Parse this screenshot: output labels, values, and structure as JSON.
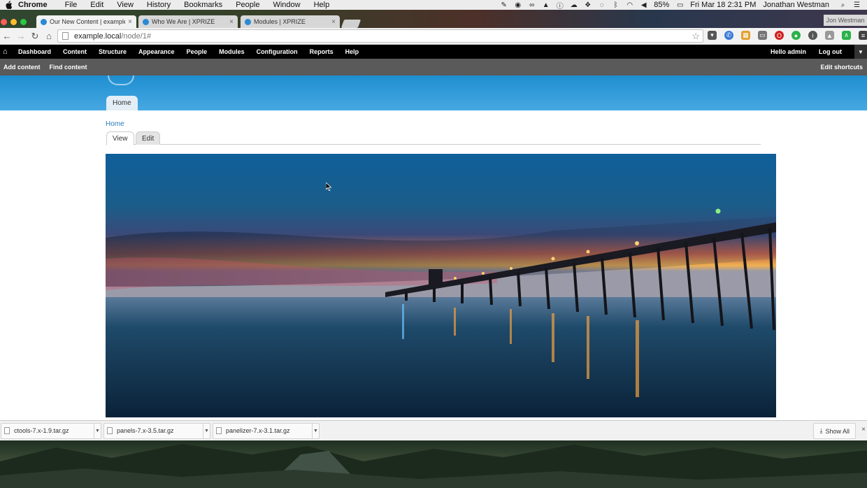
{
  "mac_menubar": {
    "app_name": "Chrome",
    "menus": [
      "File",
      "Edit",
      "View",
      "History",
      "Bookmarks",
      "People",
      "Window",
      "Help"
    ],
    "battery": "85%",
    "clock": "Fri Mar 18  2:31 PM",
    "user": "Jonathan Westman"
  },
  "browser": {
    "tabs": [
      {
        "title": "Our New Content | example",
        "active": true
      },
      {
        "title": "Who We Are | XPRIZE",
        "active": false
      },
      {
        "title": "Modules | XPRIZE",
        "active": false
      }
    ],
    "profile_name": "Jon Westman",
    "url_host": "example.local",
    "url_path": "/node/1#"
  },
  "admin_menu": {
    "items": [
      "Dashboard",
      "Content",
      "Structure",
      "Appearance",
      "People",
      "Modules",
      "Configuration",
      "Reports",
      "Help"
    ],
    "greeting_prefix": "Hello ",
    "username": "admin",
    "logout": "Log out"
  },
  "shortcuts": {
    "items": [
      "Add content",
      "Find content"
    ],
    "edit_shortcuts": "Edit shortcuts"
  },
  "site": {
    "primary_tab": "Home",
    "breadcrumb": "Home",
    "local_tabs": [
      "View",
      "Edit"
    ]
  },
  "downloads": {
    "items": [
      "ctools-7.x-1.9.tar.gz",
      "panels-7.x-3.5.tar.gz",
      "panelizer-7.x-3.1.tar.gz"
    ],
    "show_all": "Show All"
  },
  "colors": {
    "site_header": "#2a96d6",
    "admin_bar": "#000000",
    "shortcut_bar": "#5a5a5a",
    "link": "#2a7ab8"
  }
}
